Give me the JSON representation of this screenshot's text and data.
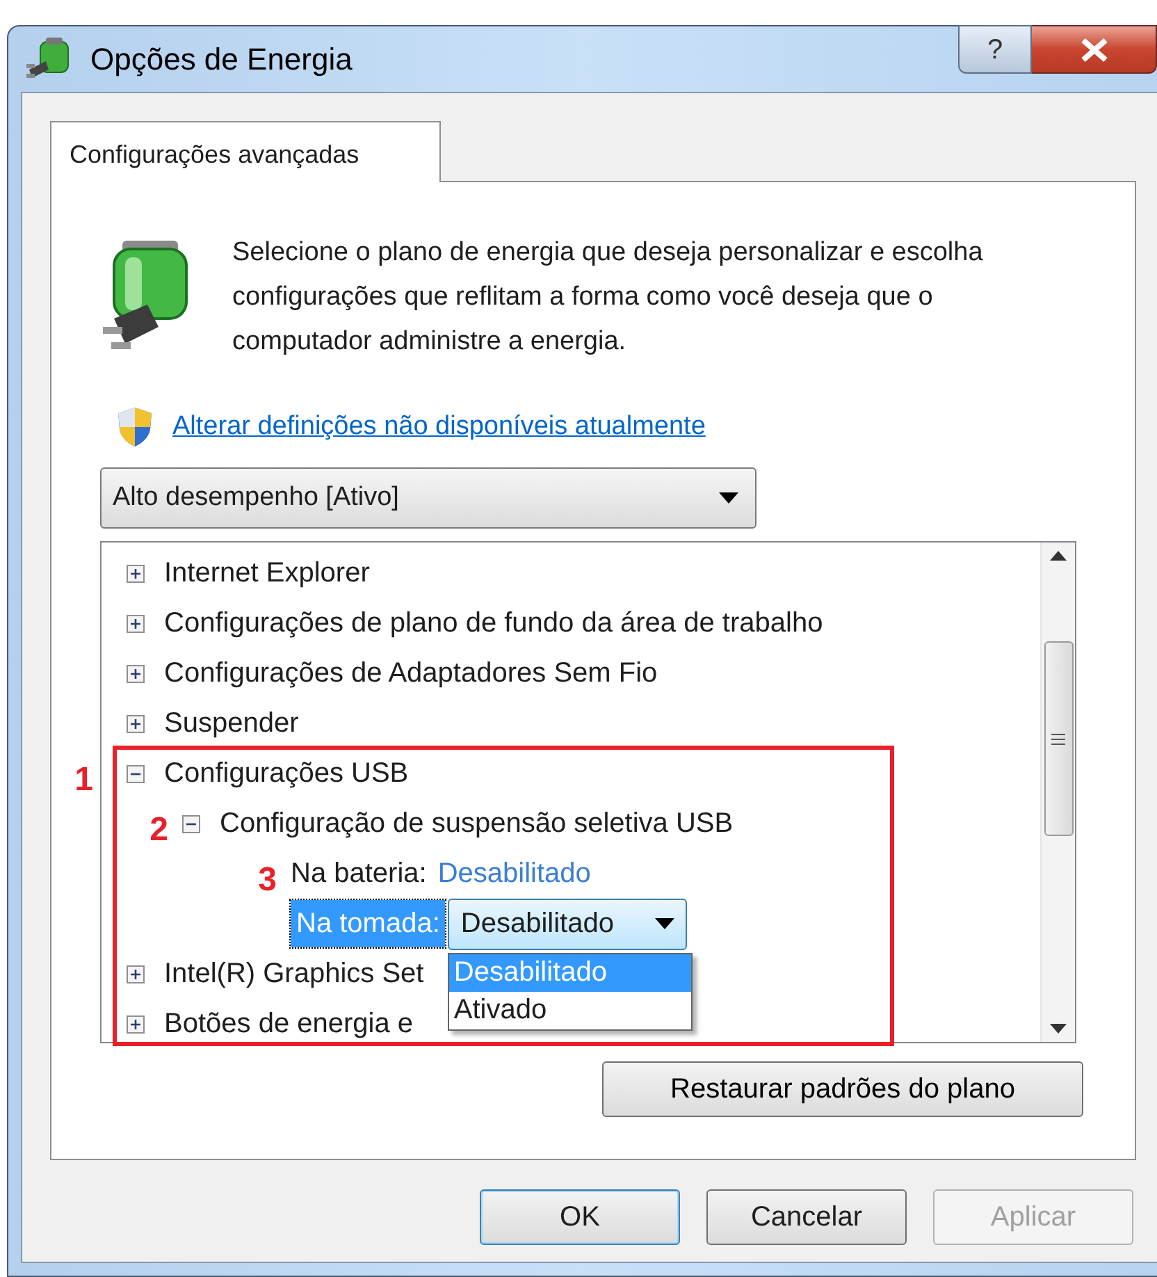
{
  "window": {
    "title": "Opções de Energia",
    "help_button": "?"
  },
  "tabs": [
    {
      "label": "Configurações avançadas",
      "selected": true
    }
  ],
  "intro": "Selecione o plano de energia que deseja personalizar e escolha configurações que reflitam a forma como você deseja que o computador administre a energia.",
  "admin_link": "Alterar definições não disponíveis atualmente",
  "plan_select": {
    "value": "Alto desempenho [Ativo]"
  },
  "tree": [
    {
      "kind": "group",
      "label": "Internet Explorer",
      "expanded": false
    },
    {
      "kind": "group",
      "label": "Configurações de plano de fundo da área de trabalho",
      "expanded": false
    },
    {
      "kind": "group",
      "label": "Configurações de Adaptadores Sem Fio",
      "expanded": false
    },
    {
      "kind": "group",
      "label": "Suspender",
      "expanded": false
    },
    {
      "kind": "group",
      "label": "Configurações USB",
      "expanded": true,
      "annotation": "1",
      "children": [
        {
          "kind": "group",
          "label": "Configuração de suspensão seletiva USB",
          "expanded": true,
          "annotation": "2",
          "children": [
            {
              "kind": "setting",
              "label": "Na bateria:",
              "value": "Desabilitado",
              "annotation": "3",
              "selected": false
            },
            {
              "kind": "dropdown",
              "label": "Na tomada:",
              "value": "Desabilitado",
              "selected": true,
              "options": [
                {
                  "label": "Desabilitado",
                  "selected": true
                },
                {
                  "label": "Ativado",
                  "selected": false
                }
              ]
            }
          ]
        }
      ]
    },
    {
      "kind": "group",
      "label": "Intel(R) Graphics Set",
      "expanded": false
    },
    {
      "kind": "group",
      "label": "Botões de energia e",
      "expanded": false
    }
  ],
  "restore_button": "Restaurar padrões do plano",
  "buttons": [
    {
      "label": "OK",
      "default": true,
      "disabled": false
    },
    {
      "label": "Cancelar",
      "default": false,
      "disabled": false
    },
    {
      "label": "Aplicar",
      "default": false,
      "disabled": true
    }
  ]
}
